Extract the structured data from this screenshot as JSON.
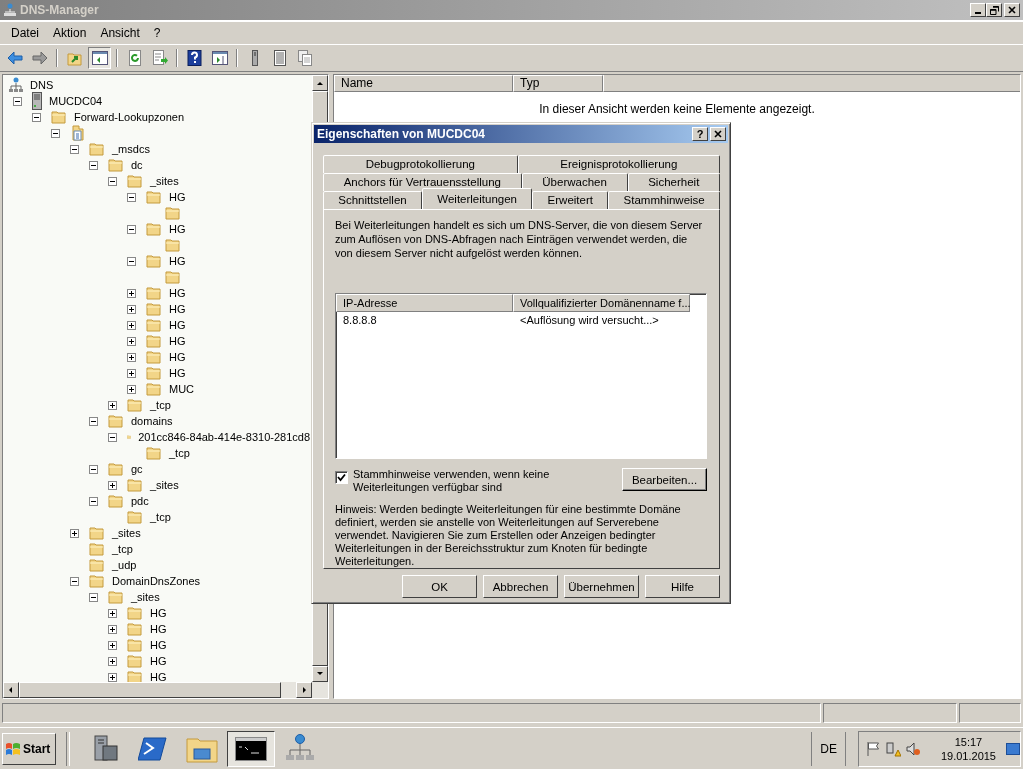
{
  "window": {
    "title": "DNS-Manager"
  },
  "menu": [
    "Datei",
    "Aktion",
    "Ansicht",
    "?"
  ],
  "tree": [
    {
      "label": "DNS",
      "kind": "dns",
      "children": [
        {
          "label": "MUCDC04",
          "kind": "server",
          "expanded": true,
          "children": [
            {
              "label": "Forward-Lookupzonen",
              "kind": "folder",
              "expanded": true,
              "children": [
                {
                  "kind": "zone",
                  "expanded": true,
                  "children": [
                    {
                      "label": "_msdcs",
                      "kind": "folder",
                      "expanded": true,
                      "children": [
                        {
                          "label": "dc",
                          "kind": "folder",
                          "expanded": true,
                          "children": [
                            {
                              "label": "_sites",
                              "kind": "folder",
                              "expanded": true,
                              "children": [
                                {
                                  "label": "HG",
                                  "kind": "folder",
                                  "expanded": true,
                                  "children": [
                                    {
                                      "kind": "folder"
                                    }
                                  ]
                                },
                                {
                                  "label": "HG",
                                  "kind": "folder",
                                  "expanded": true,
                                  "children": [
                                    {
                                      "kind": "folder"
                                    }
                                  ]
                                },
                                {
                                  "label": "HG",
                                  "kind": "folder",
                                  "expanded": true,
                                  "children": [
                                    {
                                      "kind": "folder"
                                    }
                                  ]
                                },
                                {
                                  "label": "HG",
                                  "kind": "folder",
                                  "expanded": false
                                },
                                {
                                  "label": "HG",
                                  "kind": "folder",
                                  "expanded": false
                                },
                                {
                                  "label": "HG",
                                  "kind": "folder",
                                  "expanded": false
                                },
                                {
                                  "label": "HG",
                                  "kind": "folder",
                                  "expanded": false
                                },
                                {
                                  "label": "HG",
                                  "kind": "folder",
                                  "expanded": false
                                },
                                {
                                  "label": "HG",
                                  "kind": "folder",
                                  "expanded": false
                                },
                                {
                                  "label": "MUC",
                                  "kind": "folder",
                                  "expanded": false
                                }
                              ]
                            },
                            {
                              "label": "_tcp",
                              "kind": "folder",
                              "expanded": false
                            }
                          ]
                        },
                        {
                          "label": "domains",
                          "kind": "folder",
                          "expanded": true,
                          "children": [
                            {
                              "label": "201cc846-84ab-414e-8310-281cd8",
                              "kind": "folder",
                              "expanded": true,
                              "children": [
                                {
                                  "label": "_tcp",
                                  "kind": "folder"
                                }
                              ]
                            }
                          ]
                        },
                        {
                          "label": "gc",
                          "kind": "folder",
                          "expanded": true,
                          "children": [
                            {
                              "label": "_sites",
                              "kind": "folder",
                              "expanded": false
                            }
                          ]
                        },
                        {
                          "label": "pdc",
                          "kind": "folder",
                          "expanded": true,
                          "children": [
                            {
                              "label": "_tcp",
                              "kind": "folder"
                            }
                          ]
                        }
                      ]
                    },
                    {
                      "label": "_sites",
                      "kind": "folder",
                      "expanded": false
                    },
                    {
                      "label": "_tcp",
                      "kind": "folder"
                    },
                    {
                      "label": "_udp",
                      "kind": "folder"
                    },
                    {
                      "label": "DomainDnsZones",
                      "kind": "folder",
                      "expanded": true,
                      "children": [
                        {
                          "label": "_sites",
                          "kind": "folder",
                          "expanded": true,
                          "children": [
                            {
                              "label": "HG",
                              "kind": "folder",
                              "expanded": false
                            },
                            {
                              "label": "HG",
                              "kind": "folder",
                              "expanded": false
                            },
                            {
                              "label": "HG",
                              "kind": "folder",
                              "expanded": false
                            },
                            {
                              "label": "HG",
                              "kind": "folder",
                              "expanded": false
                            },
                            {
                              "label": "HG",
                              "kind": "folder",
                              "expanded": false
                            }
                          ]
                        }
                      ]
                    }
                  ]
                }
              ]
            }
          ]
        }
      ]
    }
  ],
  "list": {
    "columns": [
      "Name",
      "Typ"
    ],
    "empty_message": "In dieser Ansicht werden keine Elemente angezeigt."
  },
  "dialog": {
    "title": "Eigenschaften von MUCDC04",
    "help_button": "?",
    "tab_rows": [
      [
        {
          "label": "Debugprotokollierung",
          "selected": false
        },
        {
          "label": "Ereignisprotokollierung",
          "selected": false
        }
      ],
      [
        {
          "label": "Anchors für Vertrauensstellung",
          "selected": false
        },
        {
          "label": "Überwachen",
          "selected": false
        },
        {
          "label": "Sicherheit",
          "selected": false
        }
      ],
      [
        {
          "label": "Schnittstellen",
          "selected": false
        },
        {
          "label": "Weiterleitungen",
          "selected": true
        },
        {
          "label": "Erweitert",
          "selected": false
        },
        {
          "label": "Stammhinweise",
          "selected": false
        }
      ]
    ],
    "description": "Bei Weiterleitungen handelt es sich um DNS-Server, die von diesem Server zum Auflösen von DNS-Abfragen nach Einträgen verwendet werden, die von diesem Server nicht aufgelöst werden können.",
    "table": {
      "columns": [
        "IP-Adresse",
        "Vollqualifizierter Domänenname f..."
      ],
      "rows": [
        [
          "8.8.8.8",
          "<Auflösung wird versucht...>"
        ]
      ]
    },
    "checkbox": {
      "label": "Stammhinweise verwenden, wenn keine Weiterleitungen verfügbar sind",
      "checked": true
    },
    "edit_button": "Bearbeiten...",
    "note": "Hinweis: Werden bedingte Weiterleitungen für eine bestimmte Domäne definiert, werden sie anstelle von Weiterleitungen auf Serverebene verwendet. Navigieren Sie zum Erstellen oder Anzeigen bedingter Weiterleitungen in der Bereichsstruktur zum Knoten für bedingte Weiterleitungen.",
    "buttons": [
      "OK",
      "Abbrechen",
      "Übernehmen",
      "Hilfe"
    ]
  },
  "taskbar": {
    "start": "Start",
    "apps": [
      {
        "kind": "server",
        "selected": false
      },
      {
        "kind": "powershell",
        "selected": false
      },
      {
        "kind": "explorer",
        "selected": false
      },
      {
        "kind": "console",
        "selected": true
      },
      {
        "kind": "network",
        "selected": false
      }
    ],
    "language": "DE",
    "time": "15:17",
    "date": "19.01.2015"
  }
}
